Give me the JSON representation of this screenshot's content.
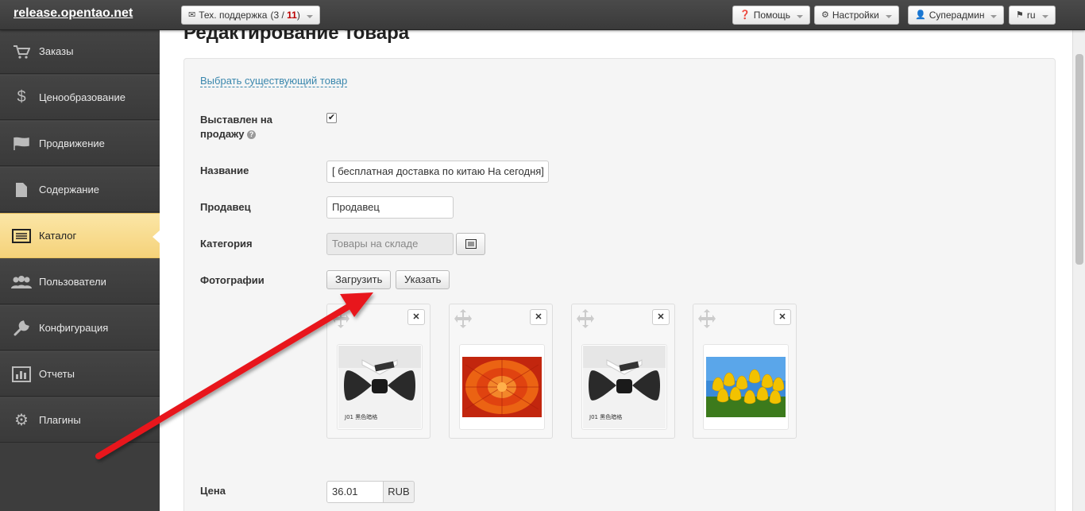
{
  "app": {
    "brand": "release.opentao.net"
  },
  "topbar": {
    "support_label": "Тех. поддержка",
    "support_open": "3",
    "support_sep": "/",
    "support_total": "11",
    "help_label": "Помощь",
    "settings_label": "Настройки",
    "user_label": "Суперадмин",
    "lang_label": "ru"
  },
  "sidebar": {
    "items": [
      {
        "label": "Заказы",
        "icon": "cart-icon"
      },
      {
        "label": "Ценообразование",
        "icon": "dollar-icon"
      },
      {
        "label": "Продвижение",
        "icon": "flag-icon"
      },
      {
        "label": "Содержание",
        "icon": "file-icon"
      },
      {
        "label": "Каталог",
        "icon": "list-icon",
        "active": true
      },
      {
        "label": "Пользователи",
        "icon": "users-icon"
      },
      {
        "label": "Конфигурация",
        "icon": "wrench-icon"
      },
      {
        "label": "Отчеты",
        "icon": "bar-chart-icon"
      },
      {
        "label": "Плагины",
        "icon": "gear-icon"
      }
    ]
  },
  "main": {
    "title": "Редактирование товара",
    "choose_link": "Выбрать существующий товар",
    "on_sale_label_1": "Выставлен на",
    "on_sale_label_2": "продажу",
    "on_sale_checked": true,
    "name_label": "Название",
    "name_value": "[ бесплатная доставка по китаю На сегодня]",
    "seller_label": "Продавец",
    "seller_value": "Продавец",
    "category_label": "Категория",
    "category_placeholder": "Товары на складе",
    "photos_label": "Фотографии",
    "upload_button": "Загрузить",
    "specify_button": "Указать",
    "photos": [
      {
        "kind": "bowtie",
        "caption": "J01 黑色暗格"
      },
      {
        "kind": "flower"
      },
      {
        "kind": "bowtie",
        "caption": "J01 黑色暗格"
      },
      {
        "kind": "tulips"
      }
    ],
    "price_label": "Цена",
    "price_value": "36.01",
    "currency": "RUB"
  },
  "colors": {
    "active_item": "#f5d27a",
    "link": "#3a87ad",
    "arrow": "#e8141b"
  }
}
